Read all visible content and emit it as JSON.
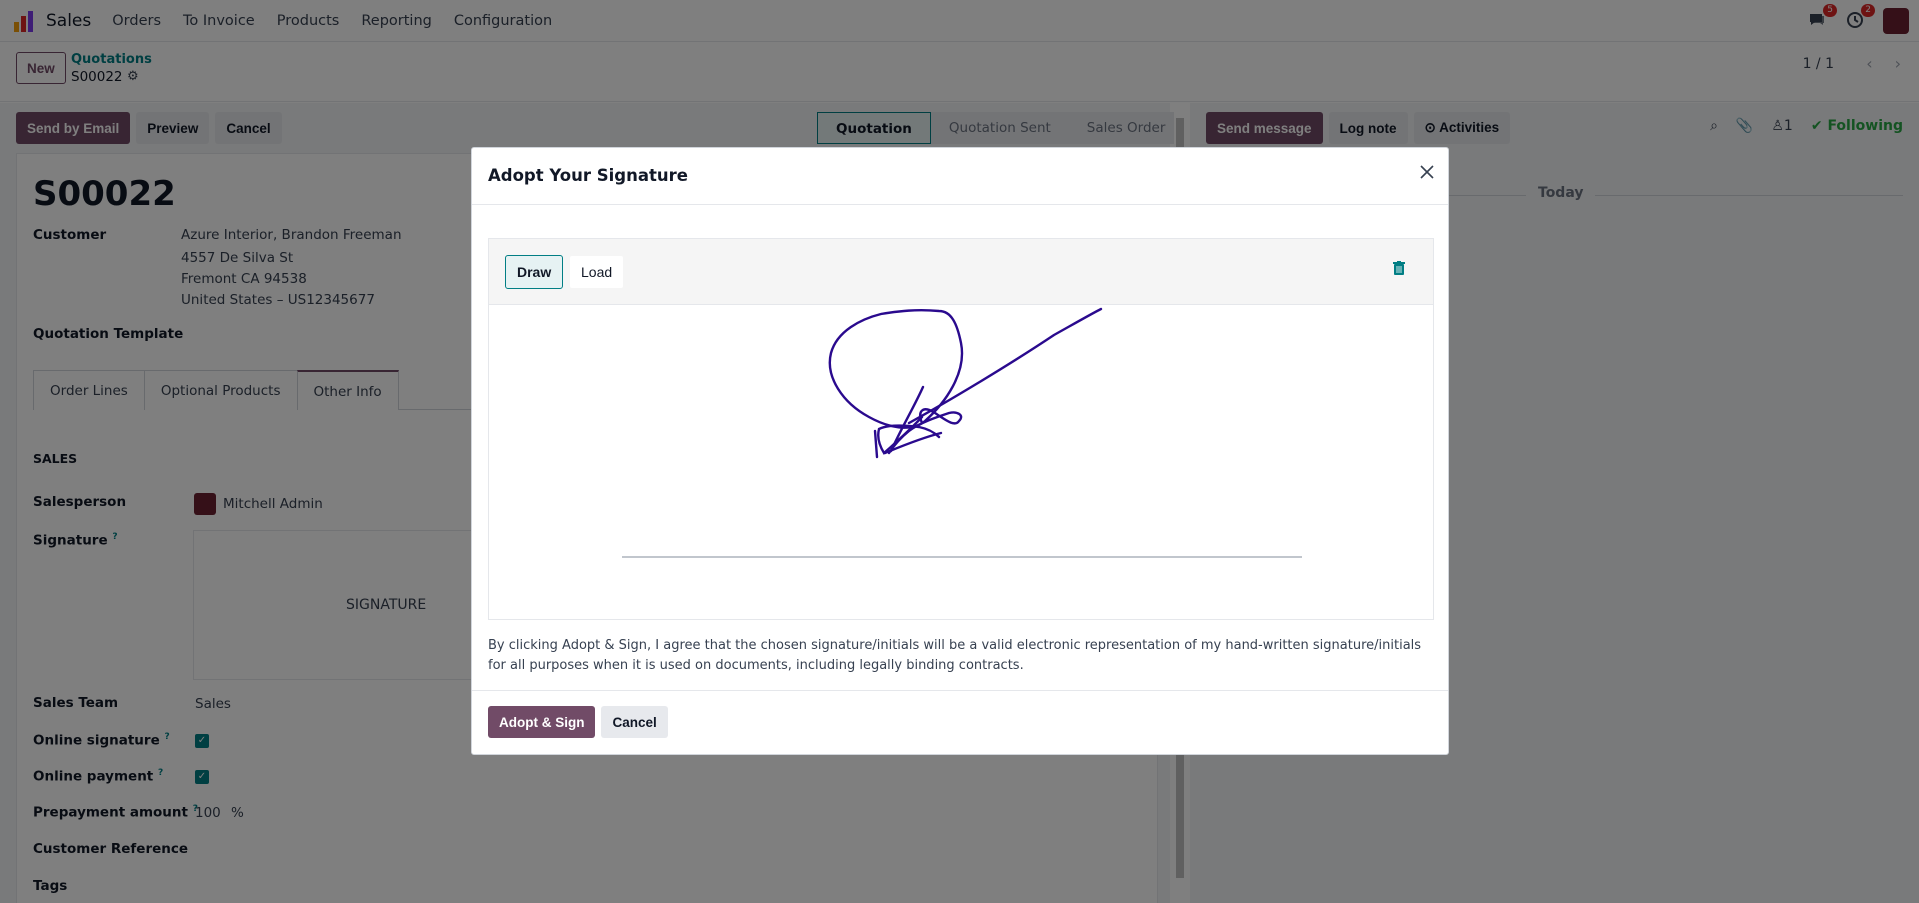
{
  "navbar": {
    "app_name": "Sales",
    "menu": [
      "Orders",
      "To Invoice",
      "Products",
      "Reporting",
      "Configuration"
    ],
    "messages_badge": "5",
    "activities_badge": "2"
  },
  "control": {
    "new_label": "New",
    "breadcrumb_parent": "Quotations",
    "breadcrumb_current": "S00022",
    "pager": "1 / 1"
  },
  "statusbar": {
    "buttons": [
      "Send by Email",
      "Preview",
      "Cancel"
    ],
    "steps": [
      "Quotation",
      "Quotation Sent",
      "Sales Order"
    ],
    "active_step": "Quotation"
  },
  "form": {
    "title": "S00022",
    "customer_label": "Customer",
    "customer_lines": [
      "Azure Interior, Brandon Freeman",
      "4557 De Silva St",
      "Fremont CA 94538",
      "United States – US12345677"
    ],
    "quotation_template_label": "Quotation Template",
    "tabs": [
      "Order Lines",
      "Optional Products",
      "Other Info"
    ],
    "active_tab": "Other Info",
    "section_sales": "SALES",
    "salesperson_label": "Salesperson",
    "salesperson_value": "Mitchell Admin",
    "signature_label": "Signature",
    "signature_placeholder": "SIGNATURE",
    "sales_team_label": "Sales Team",
    "sales_team_value": "Sales",
    "online_signature_label": "Online signature",
    "online_payment_label": "Online payment",
    "prepayment_label": "Prepayment amount",
    "prepayment_value": "100",
    "prepayment_unit": "%",
    "customer_reference_label": "Customer Reference",
    "tags_label": "Tags",
    "help_mark": "?"
  },
  "chatter": {
    "send_message": "Send message",
    "log_note": "Log note",
    "activities": "Activities",
    "followers_count": "1",
    "following": "Following",
    "today": "Today"
  },
  "modal": {
    "title": "Adopt Your Signature",
    "draw_label": "Draw",
    "load_label": "Load",
    "terms": "By clicking Adopt & Sign, I agree that the chosen signature/initials will be a valid electronic representation of my hand-written signature/initials for all purposes when it is used on documents, including legally binding contracts.",
    "adopt_label": "Adopt & Sign",
    "cancel_label": "Cancel"
  },
  "colors": {
    "primary": "#714b67",
    "accent": "#017e84",
    "signature_ink": "#2a0a8e",
    "following": "#28a745"
  }
}
